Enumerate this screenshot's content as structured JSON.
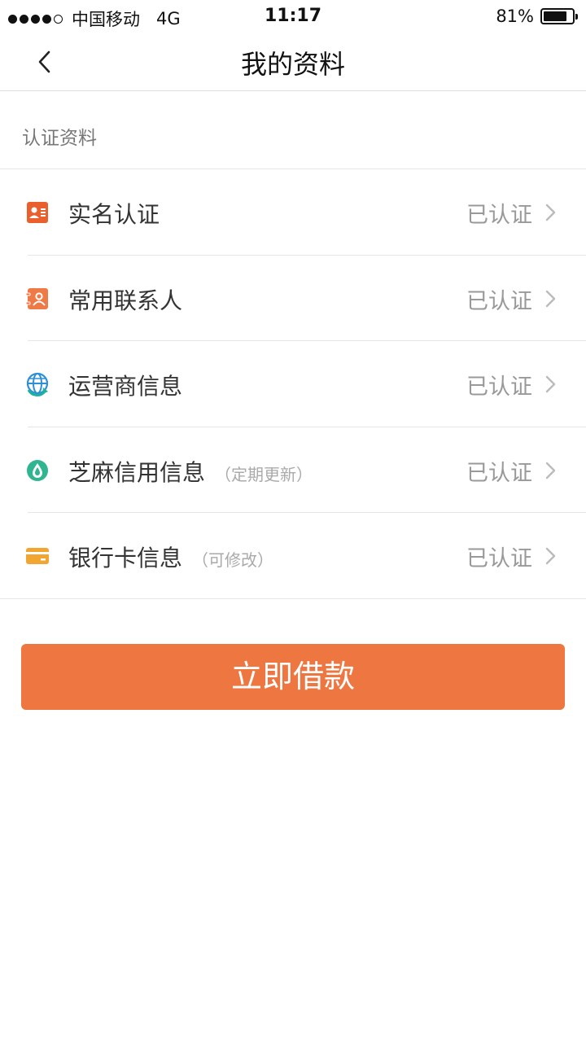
{
  "status_bar": {
    "carrier": "中国移动",
    "network": "4G",
    "time": "11:17",
    "battery": "81%",
    "battery_level": 0.81
  },
  "nav": {
    "title": "我的资料"
  },
  "section": {
    "title": "认证资料"
  },
  "items": [
    {
      "label": "实名认证",
      "note": "",
      "status": "已认证",
      "icon": "id-card-icon",
      "color": "#e9602d"
    },
    {
      "label": "常用联系人",
      "note": "",
      "status": "已认证",
      "icon": "contacts-icon",
      "color": "#ef7a45"
    },
    {
      "label": "运营商信息",
      "note": "",
      "status": "已认证",
      "icon": "carrier-globe-icon",
      "color": "#2c8fd7"
    },
    {
      "label": "芝麻信用信息",
      "note": "（定期更新）",
      "status": "已认证",
      "icon": "sesame-icon",
      "color": "#2fb58f"
    },
    {
      "label": "银行卡信息",
      "note": "（可修改）",
      "status": "已认证",
      "icon": "bank-card-icon",
      "color": "#f0a630"
    }
  ],
  "cta": {
    "label": "立即借款",
    "color": "#ed7641"
  }
}
